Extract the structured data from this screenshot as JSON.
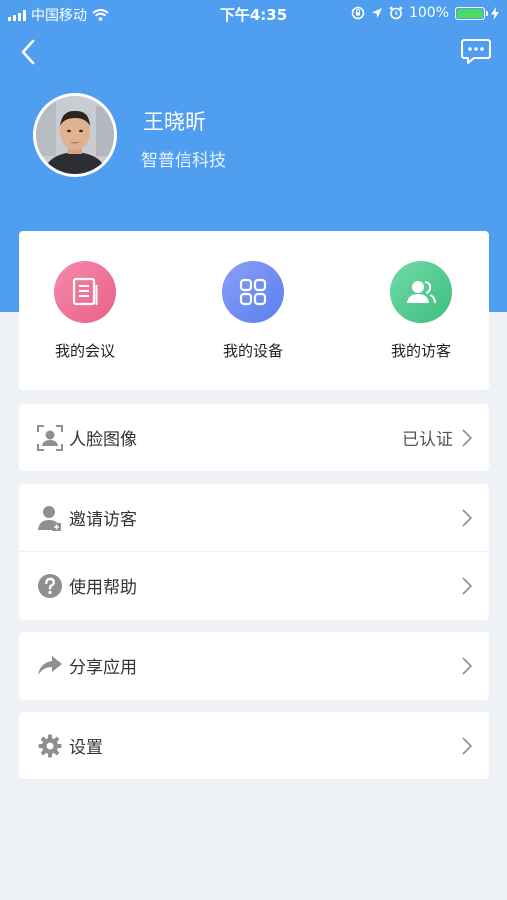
{
  "status_bar": {
    "carrier": "中国移动",
    "time": "下午4:35",
    "battery": "100%",
    "icons": [
      "signal-icon",
      "wifi-icon",
      "rotation-lock-icon",
      "location-icon",
      "alarm-icon",
      "battery-icon",
      "charging-icon"
    ]
  },
  "header": {
    "back_icon": "chevron-left-icon",
    "message_icon": "chat-bubble-icon"
  },
  "profile": {
    "name": "王晓昕",
    "company": "智普信科技"
  },
  "quick_actions": [
    {
      "label": "我的会议",
      "icon": "document-icon",
      "color": "#ee6f96"
    },
    {
      "label": "我的设备",
      "icon": "grid-icon",
      "color": "#6f8ef2"
    },
    {
      "label": "我的访客",
      "icon": "people-icon",
      "color": "#4fc98e"
    }
  ],
  "menu": {
    "face_image": {
      "label": "人脸图像",
      "value": "已认证",
      "icon": "face-scan-icon"
    },
    "invite_visitor": {
      "label": "邀请访客",
      "icon": "user-add-icon"
    },
    "help": {
      "label": "使用帮助",
      "icon": "question-circle-icon"
    },
    "share": {
      "label": "分享应用",
      "icon": "share-arrow-icon"
    },
    "settings": {
      "label": "设置",
      "icon": "gear-icon"
    }
  },
  "colors": {
    "header_blue": "#4f9ef0",
    "page_background": "#eef1f5",
    "icon_gray": "#8e8e93"
  }
}
